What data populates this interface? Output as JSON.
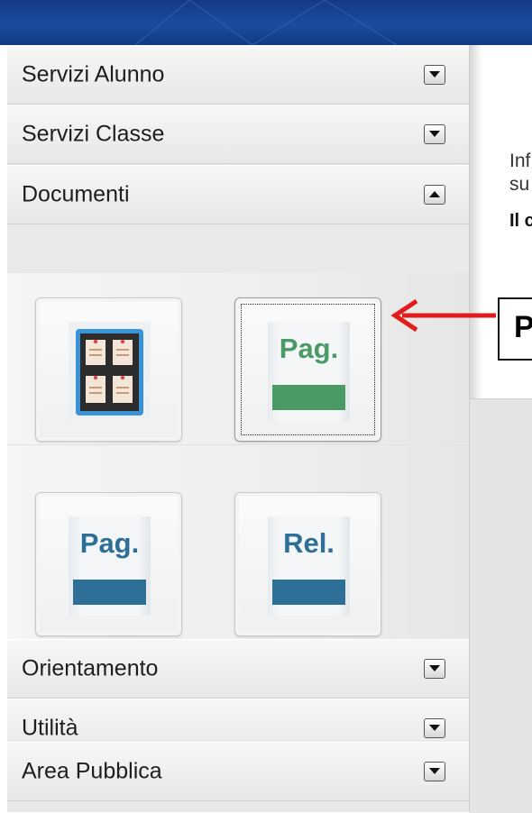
{
  "sidebar": {
    "sections": [
      {
        "label": "Servizi Alunno",
        "state": "collapsed"
      },
      {
        "label": "Servizi Classe",
        "state": "collapsed"
      },
      {
        "label": "Documenti",
        "state": "expanded"
      },
      {
        "label": "Orientamento",
        "state": "collapsed"
      },
      {
        "label": "Utilità",
        "state": "collapsed"
      },
      {
        "label": "Area Pubblica",
        "state": "collapsed"
      }
    ],
    "documents": {
      "buttons": [
        {
          "icon": "bulletin-board-icon",
          "label": ""
        },
        {
          "icon": "page-icon",
          "label": "Pag.",
          "accent": "#4a9a66"
        },
        {
          "icon": "page-icon",
          "label": "Pag.",
          "accent": "#2e6f98"
        },
        {
          "icon": "report-icon",
          "label": "Rel.",
          "accent": "#2e6f98"
        }
      ]
    }
  },
  "content": {
    "info_line_1": "Inf",
    "info_line_2": "su",
    "bold_line": "Il c"
  },
  "callout": {
    "text": "P",
    "arrow_color": "#e21b1b"
  },
  "colors": {
    "header_blue": "#1b4a9e",
    "green_accent": "#4a9a66",
    "blue_accent": "#2e6f98",
    "arrow_red": "#e21b1b"
  }
}
